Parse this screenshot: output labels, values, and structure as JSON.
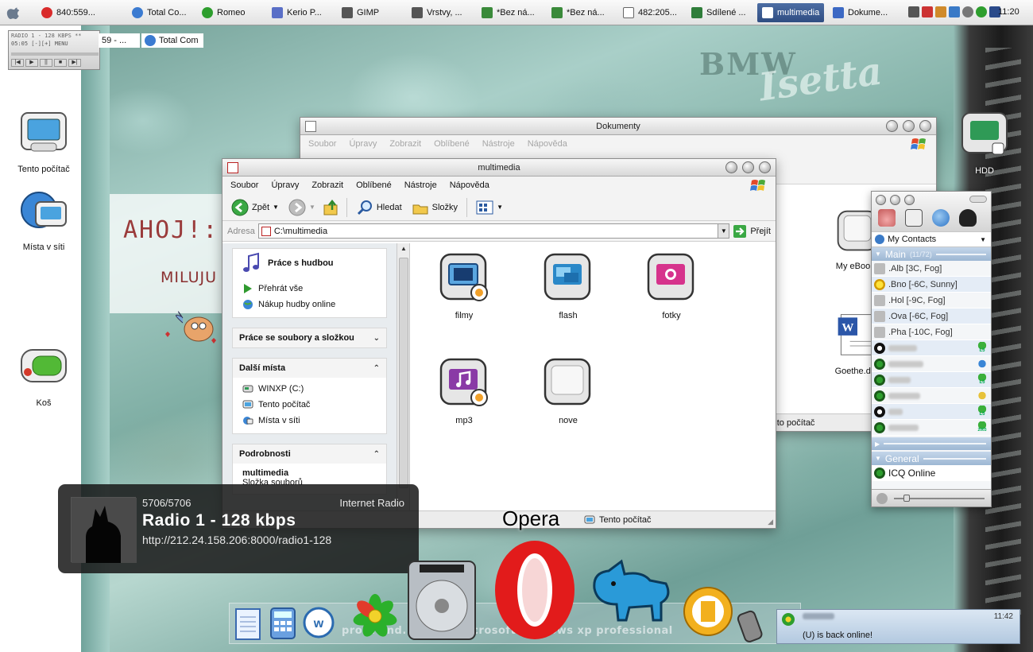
{
  "taskbar": {
    "tasks": [
      {
        "label": "840:559...",
        "color": "#d92b2b",
        "left": 0
      },
      {
        "label": "Total Co...",
        "color": "#3b7bd1"
      },
      {
        "label": "Romeo",
        "color": "#2e9e2e"
      },
      {
        "label": "Kerio P...",
        "color": "#5a6fc7"
      },
      {
        "label": "GIMP",
        "color": "#555555"
      },
      {
        "label": "Vrstvy, ...",
        "color": "#555555"
      },
      {
        "label": "*Bez ná...",
        "color": "#3a8a3a"
      },
      {
        "label": "*Bez ná...",
        "color": "#3a8a3a"
      },
      {
        "label": "482:205...",
        "color": "#666666"
      },
      {
        "label": "Sdílené ...",
        "color": "#2f7d3a"
      },
      {
        "label": "multimedia",
        "color": "#c0282b"
      },
      {
        "label": "Dokume...",
        "color": "#3c69c4"
      }
    ],
    "active_task": "multimedia",
    "clock": "11:20"
  },
  "winamp": {
    "line1": "RADIO 1 - 128 KBPS **",
    "line2": "05:05  [-][+]  MENU",
    "btns": [
      "|◀",
      "▶",
      "||",
      "■",
      "▶|"
    ]
  },
  "mini_windows": {
    "left_label": "59 - ...",
    "right_label": "Total Com"
  },
  "desktop_icons": {
    "computer": "Tento počítač",
    "network": "Místa v síti",
    "trash": "Koš",
    "hdd": "HDD"
  },
  "wallpaper": {
    "bmw": "BMW",
    "isetta": "Isetta",
    "ahoj": "AHOJ!:)",
    "miluju": "MILUJU",
    "strip": "pro... and... using microsoft windows xp professional"
  },
  "back_window": {
    "title": "Dokumenty",
    "menu": [
      "Soubor",
      "Úpravy",
      "Zobrazit",
      "Oblíbené",
      "Nástroje",
      "Nápověda"
    ],
    "items": [
      {
        "label": "My eBooks"
      },
      {
        "label": "Goethe.doc"
      }
    ],
    "status_right": "Tento počítač"
  },
  "main_window": {
    "title": "multimedia",
    "menu": [
      "Soubor",
      "Úpravy",
      "Zobrazit",
      "Oblíbené",
      "Nástroje",
      "Nápověda"
    ],
    "toolbar": {
      "back": "Zpět",
      "search": "Hledat",
      "folders": "Složky"
    },
    "address": {
      "label": "Adresa",
      "value": "C:\\multimedia",
      "go": "Přejít"
    },
    "taskpane": {
      "music_title": "Práce s hudbou",
      "music_items": [
        "Přehrát vše",
        "Nákup hudby online"
      ],
      "files_title": "Práce se soubory a složkou",
      "places_title": "Další místa",
      "places_items": [
        "WINXP (C:)",
        "Tento počítač",
        "Místa v síti"
      ],
      "details_title": "Podrobnosti",
      "details_name": "multimedia",
      "details_type": "Složka souborů"
    },
    "files": [
      {
        "label": "filmy",
        "icon": "film-folder-icon"
      },
      {
        "label": "flash",
        "icon": "flash-folder-icon"
      },
      {
        "label": "fotky",
        "icon": "photo-folder-icon"
      },
      {
        "label": "mp3",
        "icon": "music-folder-icon"
      },
      {
        "label": "nove",
        "icon": "plain-folder-icon"
      }
    ],
    "status": "Tento počítač"
  },
  "icq": {
    "my_contacts": "My Contacts",
    "group_main": "Main",
    "group_main_count": "(11/72)",
    "weather": [
      ".Alb  [3C, Fog]",
      ".Bno  [-6C, Sunny]",
      ".Hol  [-9C, Fog]",
      ".Ova  [-6C, Fog]",
      ".Pha  [-10C, Fog]"
    ],
    "badges": [
      "L5",
      "",
      "L5",
      "",
      "L5",
      "2003"
    ],
    "group_general": "General",
    "icq_online": "ICQ Online"
  },
  "radio": {
    "count": "5706/5706",
    "kind": "Internet Radio",
    "name": "Radio 1 - 128 kbps",
    "url": "http://212.24.158.206:8000/radio1-128"
  },
  "dock": {
    "label": "Opera"
  },
  "notification": {
    "time": "11:42",
    "message": "(U) is back online!"
  },
  "colors": {
    "xp_green": "#3a9d3a",
    "icq_group": "#9db7d3",
    "active_task": "#3b5b92"
  }
}
